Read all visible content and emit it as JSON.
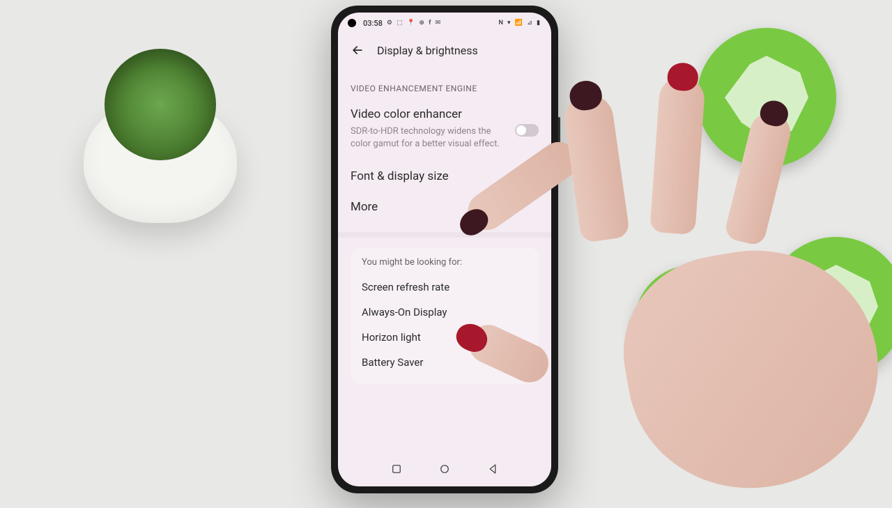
{
  "status": {
    "time": "03:58",
    "left_icons": "⚙ ⬚ 📍 ⊕ f ✉",
    "right_icons": "N ▾ 📶 ⊿ ▮"
  },
  "header": {
    "title": "Display & brightness"
  },
  "section": {
    "title": "VIDEO ENHANCEMENT ENGINE"
  },
  "enhancer": {
    "title": "Video color enhancer",
    "description": "SDR-to-HDR technology widens the color gamut for a better visual effect.",
    "enabled": false
  },
  "items": {
    "font": "Font & display size",
    "more": "More"
  },
  "suggestions": {
    "header": "You might be looking for:",
    "items": [
      "Screen refresh rate",
      "Always-On Display",
      "Horizon light",
      "Battery Saver"
    ]
  }
}
